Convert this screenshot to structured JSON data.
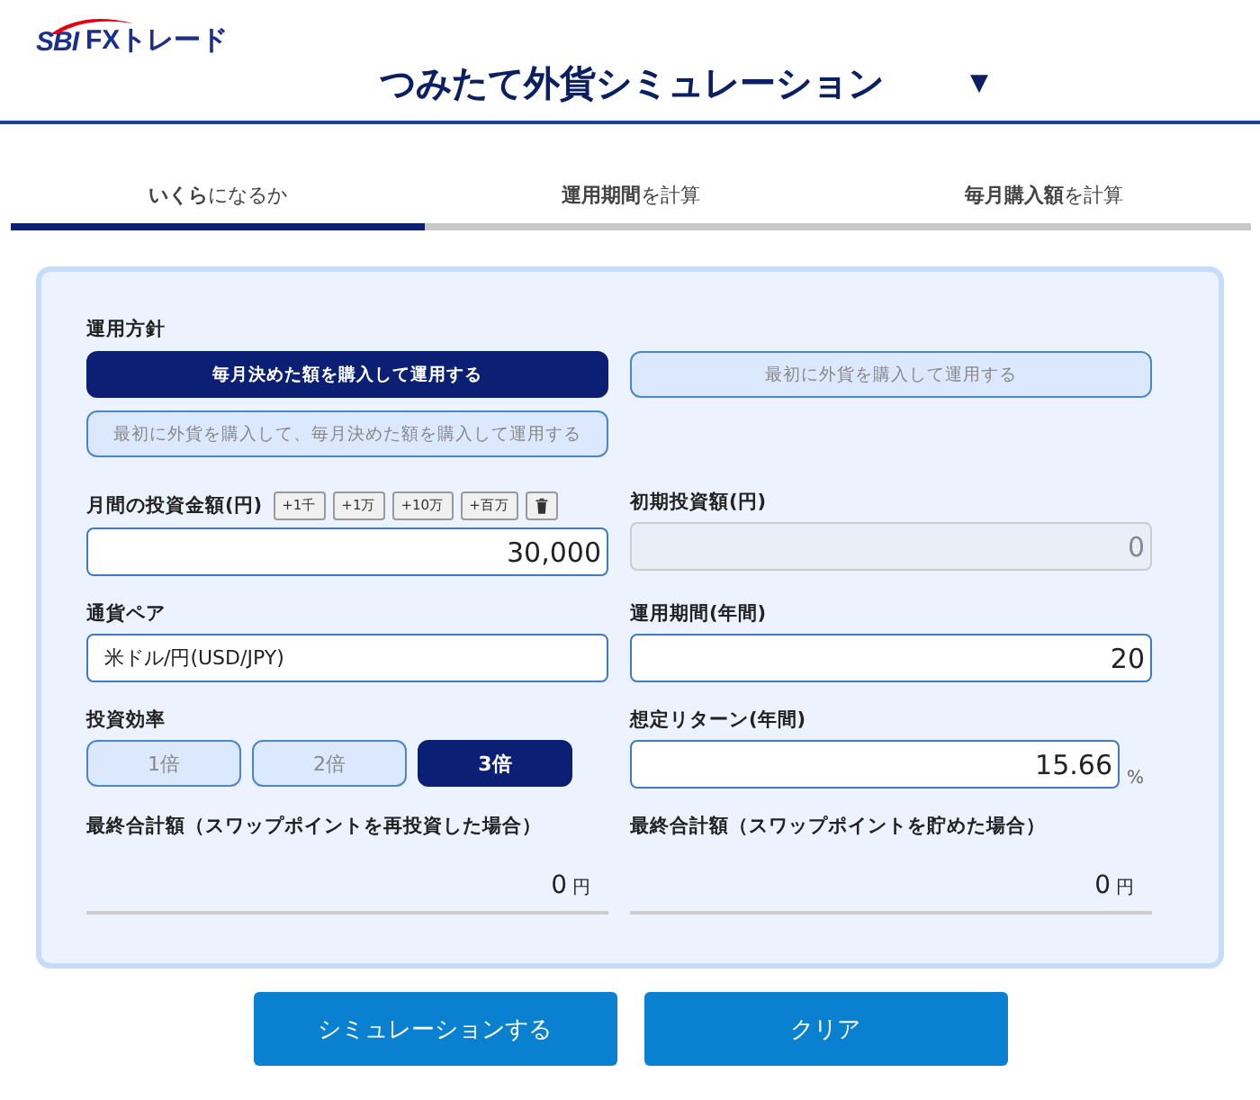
{
  "logo": {
    "mark": "SBI",
    "name": "FXトレード"
  },
  "title": "つみたて外貨シミュレーション",
  "title_toggle": "▼",
  "tabs": [
    {
      "label": "**いくら**になるか",
      "selected": true
    },
    {
      "label": "**運用期間**を計算",
      "selected": false
    },
    {
      "label": "**毎月購入額**を計算",
      "selected": false
    }
  ],
  "policy": {
    "label": "運用方針",
    "options": [
      {
        "label": "毎月決めた額を購入して運用する",
        "selected": true
      },
      {
        "label": "最初に外貨を購入して運用する",
        "selected": false
      },
      {
        "label": "最初に外貨を購入して、毎月決めた額を購入して運用する",
        "selected": false
      }
    ]
  },
  "monthly": {
    "label": "月間の投資金額(円)",
    "increments": [
      "+1千",
      "+1万",
      "+10万",
      "+百万"
    ],
    "value": "30,000"
  },
  "initial": {
    "label": "初期投資額(円)",
    "value": "0",
    "disabled": true
  },
  "pair": {
    "label": "通貨ペア",
    "value": "米ドル/円(USD/JPY)"
  },
  "period": {
    "label": "運用期間(年間)",
    "value": "20"
  },
  "leverage": {
    "label": "投資効率",
    "options": [
      {
        "label": "1倍",
        "selected": false
      },
      {
        "label": "2倍",
        "selected": false
      },
      {
        "label": "3倍",
        "selected": true
      }
    ]
  },
  "expected_return": {
    "label": "想定リターン(年間)",
    "value": "15.66",
    "unit": "%"
  },
  "results": [
    {
      "label": "最終合計額（スワップポイントを再投資した場合）",
      "value": "0",
      "unit": "円"
    },
    {
      "label": "最終合計額（スワップポイントを貯めた場合）",
      "value": "0",
      "unit": "円"
    }
  ],
  "buttons": [
    "シミュレーションする",
    "クリア"
  ]
}
